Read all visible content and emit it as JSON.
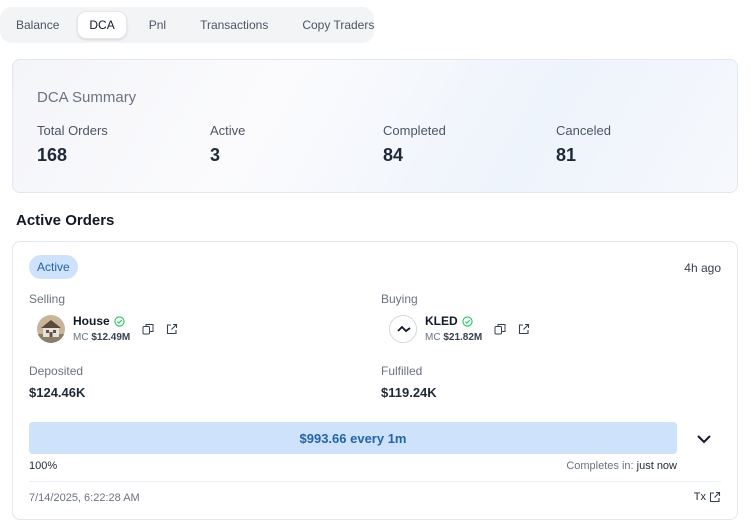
{
  "tabs": [
    {
      "label": "Balance"
    },
    {
      "label": "DCA"
    },
    {
      "label": "Pnl"
    },
    {
      "label": "Transactions"
    },
    {
      "label": "Copy Traders"
    }
  ],
  "active_tab": "DCA",
  "summary": {
    "title": "DCA Summary",
    "stats": [
      {
        "label": "Total Orders",
        "value": "168"
      },
      {
        "label": "Active",
        "value": "3"
      },
      {
        "label": "Completed",
        "value": "84"
      },
      {
        "label": "Canceled",
        "value": "81"
      }
    ]
  },
  "active_orders": {
    "title": "Active Orders",
    "order": {
      "status": "Active",
      "time_ago": "4h ago",
      "selling": {
        "label": "Selling",
        "token": "House",
        "mc_prefix": "MC",
        "mc_value": "$12.49M"
      },
      "buying": {
        "label": "Buying",
        "token": "KLED",
        "mc_prefix": "MC",
        "mc_value": "$21.82M"
      },
      "deposited": {
        "label": "Deposited",
        "value": "$124.46K"
      },
      "fulfilled": {
        "label": "Fulfilled",
        "value": "$119.24K"
      },
      "progress_text": "$993.66 every 1m",
      "progress_percent": 100,
      "progress_percent_label": "100%",
      "completes_label": "Completes in:",
      "completes_value": "just now",
      "date": "7/14/2025, 6:22:28 AM",
      "tx_label": "Tx"
    }
  },
  "colors": {
    "accent_bg": "#cfe2fb",
    "accent_text": "#2563a8",
    "verified": "#22c55e"
  },
  "icons": [
    "verified-check-icon",
    "copy-icon",
    "external-link-icon",
    "chevron-down-icon"
  ]
}
